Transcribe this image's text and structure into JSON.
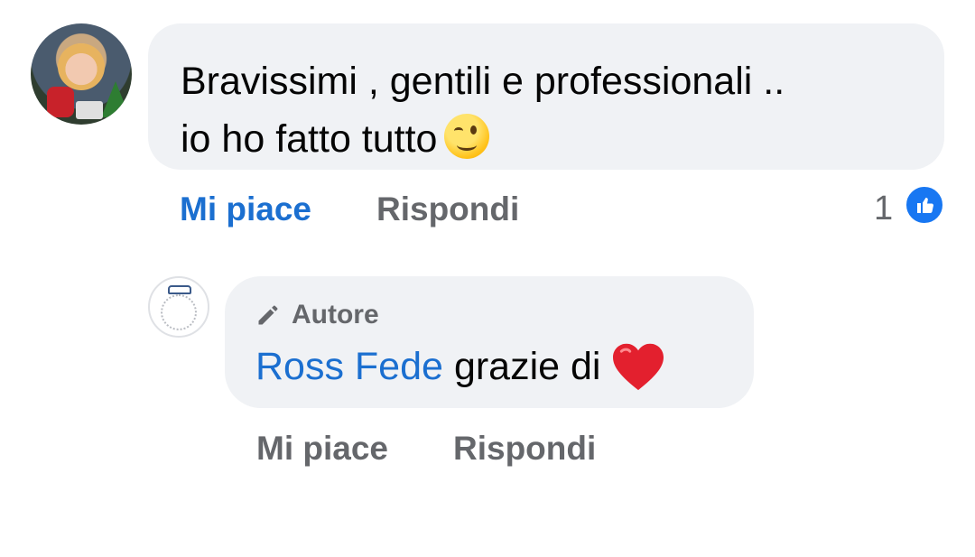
{
  "comment": {
    "line1": "Bravissimi , gentili e professionali ..",
    "line2": "io ho fatto tutto",
    "emoji": "winking-face",
    "like_label": "Mi piace",
    "reply_label": "Rispondi",
    "like_count": "1"
  },
  "reply": {
    "author_tag": "Autore",
    "mention": "Ross Fede",
    "text": "grazie di",
    "emoji": "red-heart",
    "like_label": "Mi piace",
    "reply_label": "Rispondi"
  },
  "colors": {
    "link_blue": "#1b6fd0",
    "like_badge": "#1877f2",
    "bubble_bg": "#f0f2f5",
    "muted_text": "#65676b"
  }
}
